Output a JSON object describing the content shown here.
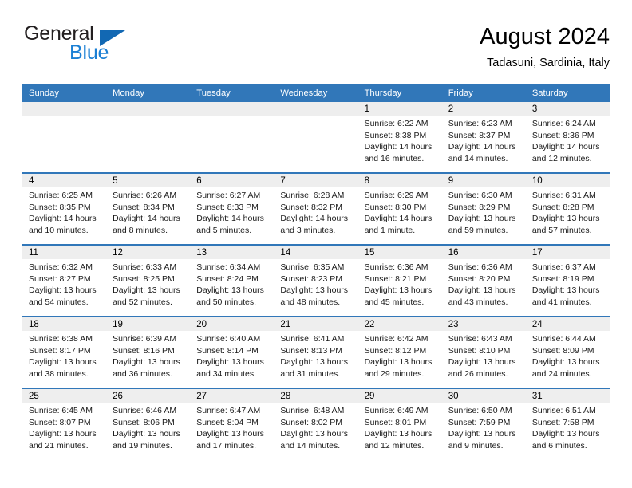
{
  "brand": {
    "word_one": "General",
    "word_two": "Blue",
    "triangle_icon": "blue-triangle-icon",
    "color_dark": "#231f20",
    "color_blue": "#1a7fd4",
    "triangle_color": "#1268b3"
  },
  "header": {
    "title": "August 2024",
    "subtitle": "Tadasuni, Sardinia, Italy"
  },
  "theme": {
    "header_bg": "#3177b9",
    "daynum_bg": "#eeeeee",
    "cell_bg": "#ffffff",
    "text": "#000000"
  },
  "calendar": {
    "weekday_headers": [
      "Sunday",
      "Monday",
      "Tuesday",
      "Wednesday",
      "Thursday",
      "Friday",
      "Saturday"
    ],
    "weeks": [
      [
        {
          "day": "",
          "lines": []
        },
        {
          "day": "",
          "lines": []
        },
        {
          "day": "",
          "lines": []
        },
        {
          "day": "",
          "lines": []
        },
        {
          "day": "1",
          "lines": [
            "Sunrise: 6:22 AM",
            "Sunset: 8:38 PM",
            "Daylight: 14 hours",
            "and 16 minutes."
          ]
        },
        {
          "day": "2",
          "lines": [
            "Sunrise: 6:23 AM",
            "Sunset: 8:37 PM",
            "Daylight: 14 hours",
            "and 14 minutes."
          ]
        },
        {
          "day": "3",
          "lines": [
            "Sunrise: 6:24 AM",
            "Sunset: 8:36 PM",
            "Daylight: 14 hours",
            "and 12 minutes."
          ]
        }
      ],
      [
        {
          "day": "4",
          "lines": [
            "Sunrise: 6:25 AM",
            "Sunset: 8:35 PM",
            "Daylight: 14 hours",
            "and 10 minutes."
          ]
        },
        {
          "day": "5",
          "lines": [
            "Sunrise: 6:26 AM",
            "Sunset: 8:34 PM",
            "Daylight: 14 hours",
            "and 8 minutes."
          ]
        },
        {
          "day": "6",
          "lines": [
            "Sunrise: 6:27 AM",
            "Sunset: 8:33 PM",
            "Daylight: 14 hours",
            "and 5 minutes."
          ]
        },
        {
          "day": "7",
          "lines": [
            "Sunrise: 6:28 AM",
            "Sunset: 8:32 PM",
            "Daylight: 14 hours",
            "and 3 minutes."
          ]
        },
        {
          "day": "8",
          "lines": [
            "Sunrise: 6:29 AM",
            "Sunset: 8:30 PM",
            "Daylight: 14 hours",
            "and 1 minute."
          ]
        },
        {
          "day": "9",
          "lines": [
            "Sunrise: 6:30 AM",
            "Sunset: 8:29 PM",
            "Daylight: 13 hours",
            "and 59 minutes."
          ]
        },
        {
          "day": "10",
          "lines": [
            "Sunrise: 6:31 AM",
            "Sunset: 8:28 PM",
            "Daylight: 13 hours",
            "and 57 minutes."
          ]
        }
      ],
      [
        {
          "day": "11",
          "lines": [
            "Sunrise: 6:32 AM",
            "Sunset: 8:27 PM",
            "Daylight: 13 hours",
            "and 54 minutes."
          ]
        },
        {
          "day": "12",
          "lines": [
            "Sunrise: 6:33 AM",
            "Sunset: 8:25 PM",
            "Daylight: 13 hours",
            "and 52 minutes."
          ]
        },
        {
          "day": "13",
          "lines": [
            "Sunrise: 6:34 AM",
            "Sunset: 8:24 PM",
            "Daylight: 13 hours",
            "and 50 minutes."
          ]
        },
        {
          "day": "14",
          "lines": [
            "Sunrise: 6:35 AM",
            "Sunset: 8:23 PM",
            "Daylight: 13 hours",
            "and 48 minutes."
          ]
        },
        {
          "day": "15",
          "lines": [
            "Sunrise: 6:36 AM",
            "Sunset: 8:21 PM",
            "Daylight: 13 hours",
            "and 45 minutes."
          ]
        },
        {
          "day": "16",
          "lines": [
            "Sunrise: 6:36 AM",
            "Sunset: 8:20 PM",
            "Daylight: 13 hours",
            "and 43 minutes."
          ]
        },
        {
          "day": "17",
          "lines": [
            "Sunrise: 6:37 AM",
            "Sunset: 8:19 PM",
            "Daylight: 13 hours",
            "and 41 minutes."
          ]
        }
      ],
      [
        {
          "day": "18",
          "lines": [
            "Sunrise: 6:38 AM",
            "Sunset: 8:17 PM",
            "Daylight: 13 hours",
            "and 38 minutes."
          ]
        },
        {
          "day": "19",
          "lines": [
            "Sunrise: 6:39 AM",
            "Sunset: 8:16 PM",
            "Daylight: 13 hours",
            "and 36 minutes."
          ]
        },
        {
          "day": "20",
          "lines": [
            "Sunrise: 6:40 AM",
            "Sunset: 8:14 PM",
            "Daylight: 13 hours",
            "and 34 minutes."
          ]
        },
        {
          "day": "21",
          "lines": [
            "Sunrise: 6:41 AM",
            "Sunset: 8:13 PM",
            "Daylight: 13 hours",
            "and 31 minutes."
          ]
        },
        {
          "day": "22",
          "lines": [
            "Sunrise: 6:42 AM",
            "Sunset: 8:12 PM",
            "Daylight: 13 hours",
            "and 29 minutes."
          ]
        },
        {
          "day": "23",
          "lines": [
            "Sunrise: 6:43 AM",
            "Sunset: 8:10 PM",
            "Daylight: 13 hours",
            "and 26 minutes."
          ]
        },
        {
          "day": "24",
          "lines": [
            "Sunrise: 6:44 AM",
            "Sunset: 8:09 PM",
            "Daylight: 13 hours",
            "and 24 minutes."
          ]
        }
      ],
      [
        {
          "day": "25",
          "lines": [
            "Sunrise: 6:45 AM",
            "Sunset: 8:07 PM",
            "Daylight: 13 hours",
            "and 21 minutes."
          ]
        },
        {
          "day": "26",
          "lines": [
            "Sunrise: 6:46 AM",
            "Sunset: 8:06 PM",
            "Daylight: 13 hours",
            "and 19 minutes."
          ]
        },
        {
          "day": "27",
          "lines": [
            "Sunrise: 6:47 AM",
            "Sunset: 8:04 PM",
            "Daylight: 13 hours",
            "and 17 minutes."
          ]
        },
        {
          "day": "28",
          "lines": [
            "Sunrise: 6:48 AM",
            "Sunset: 8:02 PM",
            "Daylight: 13 hours",
            "and 14 minutes."
          ]
        },
        {
          "day": "29",
          "lines": [
            "Sunrise: 6:49 AM",
            "Sunset: 8:01 PM",
            "Daylight: 13 hours",
            "and 12 minutes."
          ]
        },
        {
          "day": "30",
          "lines": [
            "Sunrise: 6:50 AM",
            "Sunset: 7:59 PM",
            "Daylight: 13 hours",
            "and 9 minutes."
          ]
        },
        {
          "day": "31",
          "lines": [
            "Sunrise: 6:51 AM",
            "Sunset: 7:58 PM",
            "Daylight: 13 hours",
            "and 6 minutes."
          ]
        }
      ]
    ]
  }
}
